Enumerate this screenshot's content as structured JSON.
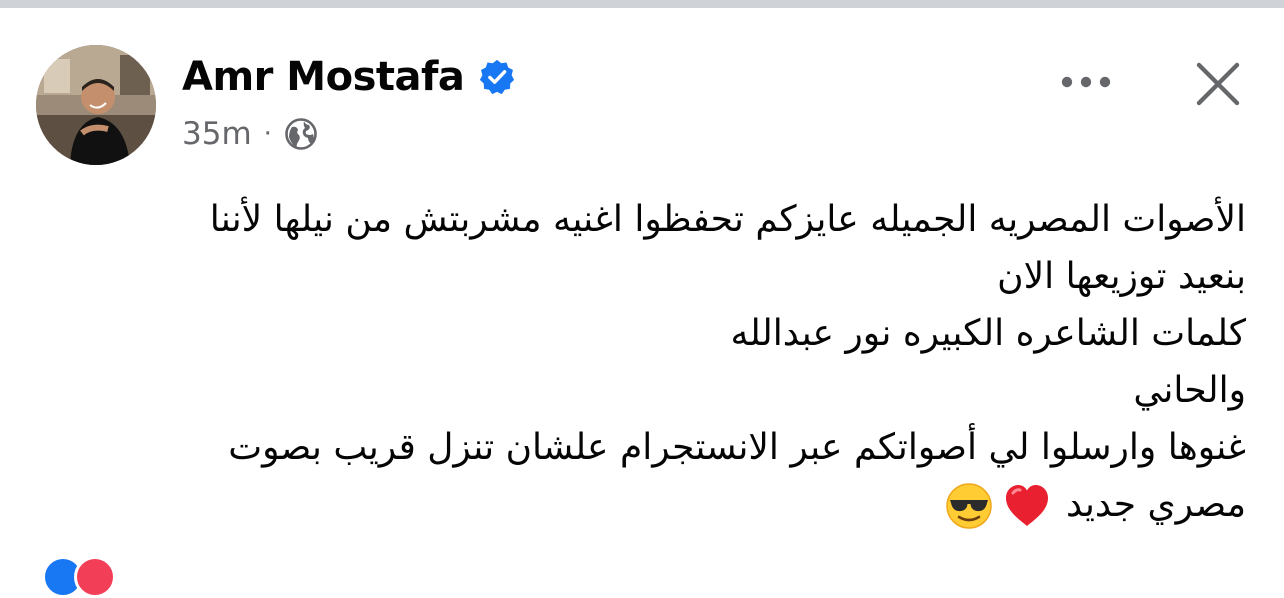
{
  "post": {
    "author_name": "Amr Mostafa",
    "verified_badge": "verified-icon",
    "timestamp": "35m",
    "separator": "·",
    "audience_icon": "globe-icon",
    "menu_icon": "more-horizontal-icon",
    "close_icon": "close-icon",
    "body_lines": [
      "الأصوات المصريه الجميله عايزكم تحفظوا اغنيه مشربتش من نيلها لأننا",
      "بنعيد توزيعها الان",
      "كلمات الشاعره الكبيره نور عبدالله",
      "والحاني",
      "غنوها وارسلوا لي أصواتكم عبر الانستجرام علشان تنزل قريب بصوت",
      "مصري جديد"
    ],
    "emojis": [
      "red-heart",
      "smiling-face-with-sunglasses"
    ],
    "reaction_icons": [
      "like-reaction-icon",
      "love-reaction-icon"
    ]
  },
  "colors": {
    "text_primary": "#050505",
    "text_secondary": "#65676b",
    "verified_blue": "#1877f2",
    "top_strip": "#cfd2d6"
  }
}
